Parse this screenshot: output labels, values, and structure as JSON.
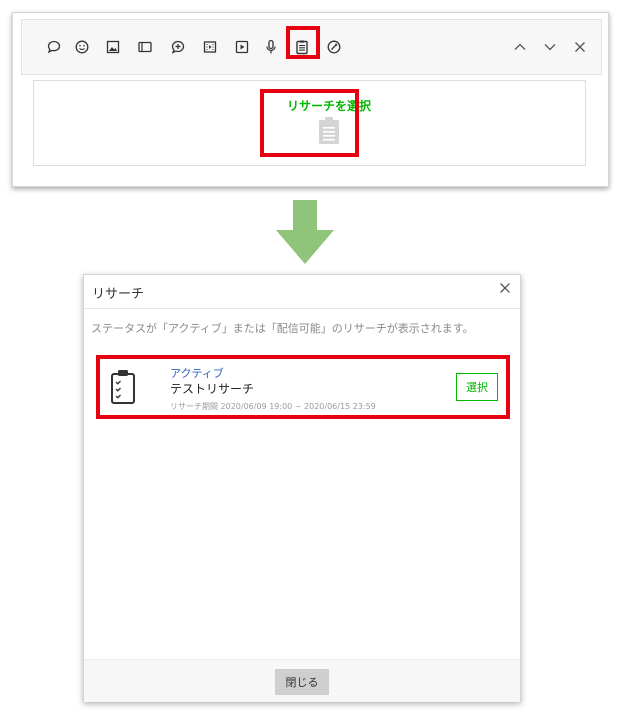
{
  "editor": {
    "toolbar": {
      "icons": [
        "speech-bubble",
        "smiley",
        "image",
        "card",
        "sticker-bubble",
        "video",
        "video-play",
        "microphone",
        "research",
        "coupon"
      ],
      "nav_icons": [
        "chevron-up",
        "chevron-down",
        "close"
      ]
    },
    "select_research_label": "リサーチを選択"
  },
  "modal": {
    "title": "リサーチ",
    "description": "ステータスが「アクティブ」または「配信可能」のリサーチが表示されます。",
    "item": {
      "status": "アクティブ",
      "name": "テストリサーチ",
      "period": "リサーチ期間 2020/06/09 19:00 ~ 2020/06/15 23:59",
      "select_label": "選択"
    },
    "close_label": "閉じる"
  },
  "colors": {
    "highlight": "#e60012",
    "brand_green": "#00b900",
    "status_blue": "#2d63c6",
    "arrow": "#8fc57a"
  }
}
